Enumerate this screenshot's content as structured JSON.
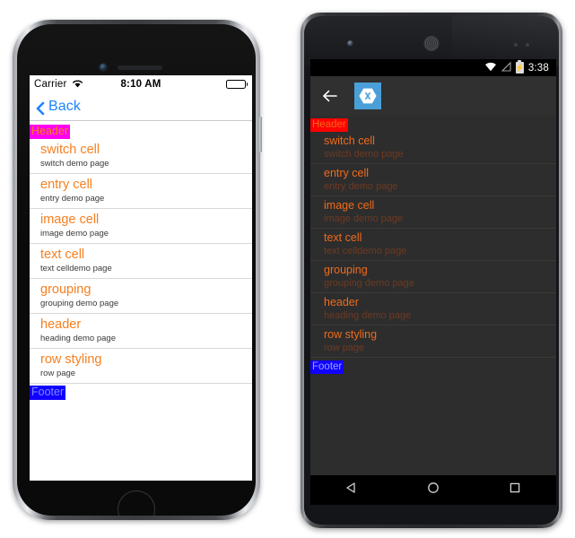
{
  "ios": {
    "status": {
      "carrier": "Carrier",
      "wifi_icon": "wifi-icon",
      "time": "8:10 AM",
      "battery_icon": "battery-full-icon"
    },
    "nav": {
      "back_icon": "chevron-left-icon",
      "back_label": "Back"
    },
    "section_header": "Header",
    "section_footer": "Footer",
    "cells": [
      {
        "title": "switch cell",
        "detail": "switch demo page"
      },
      {
        "title": "entry cell",
        "detail": "entry demo page"
      },
      {
        "title": "image cell",
        "detail": "image demo page"
      },
      {
        "title": "text cell",
        "detail": "text celldemo page"
      },
      {
        "title": "grouping",
        "detail": "grouping demo page"
      },
      {
        "title": "header",
        "detail": "heading demo page"
      },
      {
        "title": "row styling",
        "detail": "row page"
      }
    ],
    "colors": {
      "title": "#F58020",
      "detail": "#3a3a3a",
      "header_bg": "#FF00F0",
      "header_text": "#F58020",
      "footer_bg": "#1200FF",
      "footer_text": "#7A8CFF",
      "back_link": "#1B84FF",
      "screen_bg": "#FFFFFF"
    },
    "hardware": {
      "camera": "front-camera",
      "speaker": "earpiece-speaker",
      "home_button": "home-button"
    }
  },
  "android": {
    "status": {
      "wifi_icon": "wifi-icon",
      "signal_icon": "no-signal-icon",
      "battery_icon": "battery-charging-icon",
      "time": "3:38"
    },
    "actionbar": {
      "back_icon": "arrow-left-icon",
      "app_logo": "xamarin-logo",
      "logo_bg": "#4A9FD8"
    },
    "section_header": "Header",
    "section_footer": "Footer",
    "cells": [
      {
        "title": "switch cell",
        "detail": "switch demo page"
      },
      {
        "title": "entry cell",
        "detail": "entry demo page"
      },
      {
        "title": "image cell",
        "detail": "image demo page"
      },
      {
        "title": "text cell",
        "detail": "text celldemo page"
      },
      {
        "title": "grouping",
        "detail": "grouping demo page"
      },
      {
        "title": "header",
        "detail": "heading demo page"
      },
      {
        "title": "row styling",
        "detail": "row page"
      }
    ],
    "navbar": {
      "back": "nav-back-triangle-icon",
      "home": "nav-home-circle-icon",
      "recents": "nav-recents-square-icon"
    },
    "colors": {
      "title": "#F06B1A",
      "detail": "#6E3A22",
      "header_bg": "#FF0000",
      "header_text": "#F06B1A",
      "footer_bg": "#1200FF",
      "footer_text": "#93A7FF",
      "screen_bg": "#2D2D2D",
      "actionbar_bg": "#303030"
    },
    "hardware": {
      "camera": "front-camera",
      "speaker": "earpiece-speaker",
      "sensors": "proximity-sensors"
    }
  }
}
